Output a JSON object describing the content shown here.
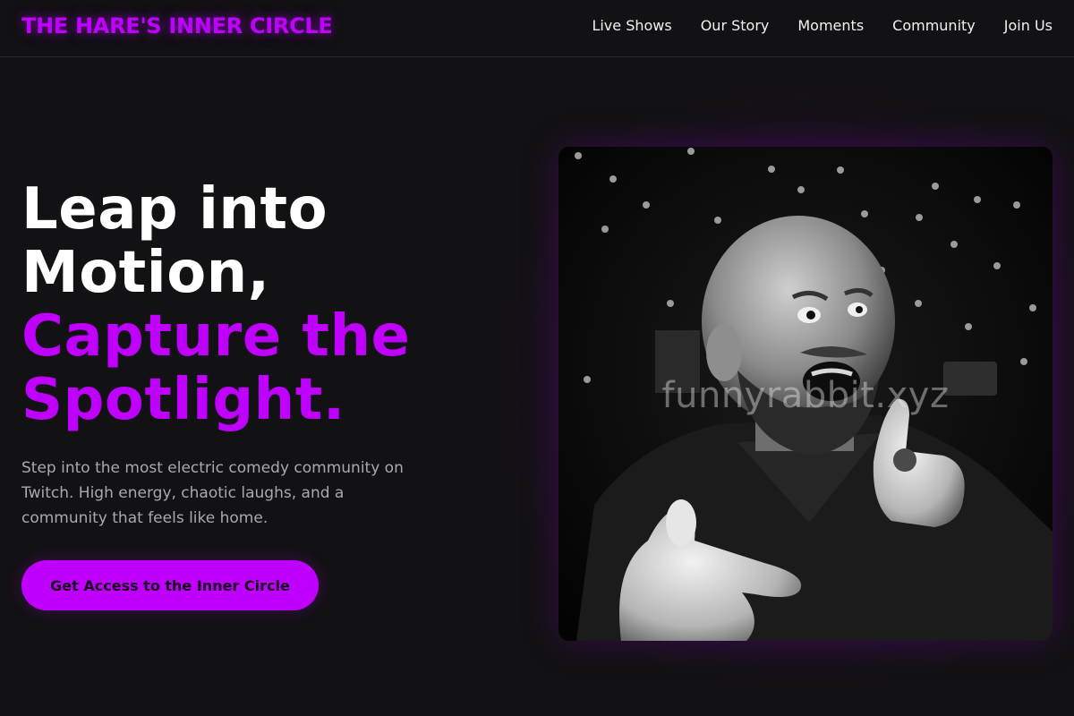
{
  "nav": {
    "brand": "THE HARE'S INNER CIRCLE",
    "links": [
      {
        "label": "Live Shows"
      },
      {
        "label": "Our Story"
      },
      {
        "label": "Moments"
      },
      {
        "label": "Community"
      },
      {
        "label": "Join Us"
      }
    ]
  },
  "hero": {
    "headline_white": [
      "Leap into",
      "Motion,"
    ],
    "headline_accent": [
      "Capture the",
      "Spotlight."
    ],
    "subtext": "Step into the most electric comedy community on Twitch. High energy, chaotic laughs, and a community that feels like home.",
    "cta_label": "Get Access to the Inner Circle",
    "image_watermark": "funnyrabbit.xyz"
  },
  "colors": {
    "accent": "#bf00ff",
    "background": "#121113",
    "muted_text": "#a9a9ae"
  }
}
